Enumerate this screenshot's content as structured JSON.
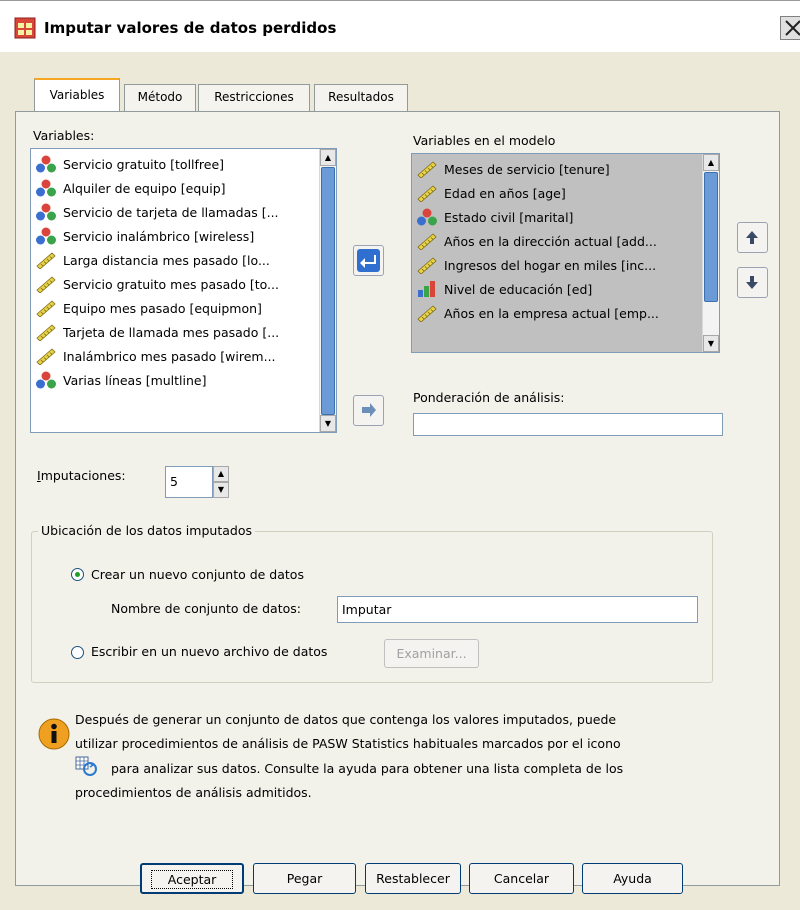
{
  "window": {
    "title": "Imputar valores de datos perdidos"
  },
  "tabs": [
    {
      "label": "Variables"
    },
    {
      "label": "Método"
    },
    {
      "label": "Restricciones"
    },
    {
      "label": "Resultados"
    }
  ],
  "variables": {
    "label": "Variables:",
    "items": [
      {
        "label": "Servicio gratuito [tollfree]",
        "icon": "nominal-icon"
      },
      {
        "label": "Alquiler de equipo [equip]",
        "icon": "nominal-icon"
      },
      {
        "label": "Servicio de tarjeta de llamadas [...",
        "icon": "nominal-icon"
      },
      {
        "label": "Servicio inalámbrico [wireless]",
        "icon": "nominal-icon"
      },
      {
        "label": "Larga distancia mes pasado [lo...",
        "icon": "scale-icon"
      },
      {
        "label": "Servicio gratuito mes pasado [to...",
        "icon": "scale-icon"
      },
      {
        "label": "Equipo mes pasado [equipmon]",
        "icon": "scale-icon"
      },
      {
        "label": "Tarjeta de llamada mes pasado [...",
        "icon": "scale-icon"
      },
      {
        "label": "Inalámbrico mes pasado [wirem...",
        "icon": "scale-icon"
      },
      {
        "label": "Varias líneas [multline]",
        "icon": "nominal-icon"
      }
    ]
  },
  "model_variables": {
    "label": "Variables en el modelo",
    "items": [
      {
        "label": "Meses de servicio [tenure]",
        "icon": "scale-icon"
      },
      {
        "label": "Edad en años [age]",
        "icon": "scale-icon"
      },
      {
        "label": "Estado civil [marital]",
        "icon": "nominal-icon"
      },
      {
        "label": "Años en la dirección actual [add...",
        "icon": "scale-icon"
      },
      {
        "label": "Ingresos del hogar en miles [inc...",
        "icon": "scale-icon"
      },
      {
        "label": "Nivel de educación [ed]",
        "icon": "ordinal-icon"
      },
      {
        "label": "Años en la empresa actual [emp...",
        "icon": "scale-icon"
      }
    ]
  },
  "weight": {
    "label": "Ponderación de análisis:",
    "value": ""
  },
  "imputations": {
    "label": "Imputaciones:",
    "value": "5"
  },
  "location": {
    "legend": "Ubicación de los datos imputados",
    "option_new_dataset": "Crear un nuevo conjunto de datos",
    "dataset_name_label": "Nombre de conjunto de datos:",
    "dataset_name_value": "Imputar",
    "option_new_file": "Escribir en un nuevo archivo de datos",
    "browse_label": "Examinar..."
  },
  "info": {
    "text_1": "Después de generar un conjunto de datos que contenga los valores imputados, puede",
    "text_2": "utilizar procedimientos de análisis de PASW Statistics habituales marcados por el icono",
    "text_3": "para analizar sus datos. Consulte la ayuda para obtener una lista completa de los",
    "text_4": "procedimientos de análisis admitidos."
  },
  "buttons": {
    "ok": "Aceptar",
    "paste": "Pegar",
    "reset": "Restablecer",
    "cancel": "Cancelar",
    "help": "Ayuda"
  },
  "colors": {
    "selection": "#c0c0c0",
    "scroll_thumb": "#6b9bd6",
    "tab_accent": "#f5a623"
  }
}
